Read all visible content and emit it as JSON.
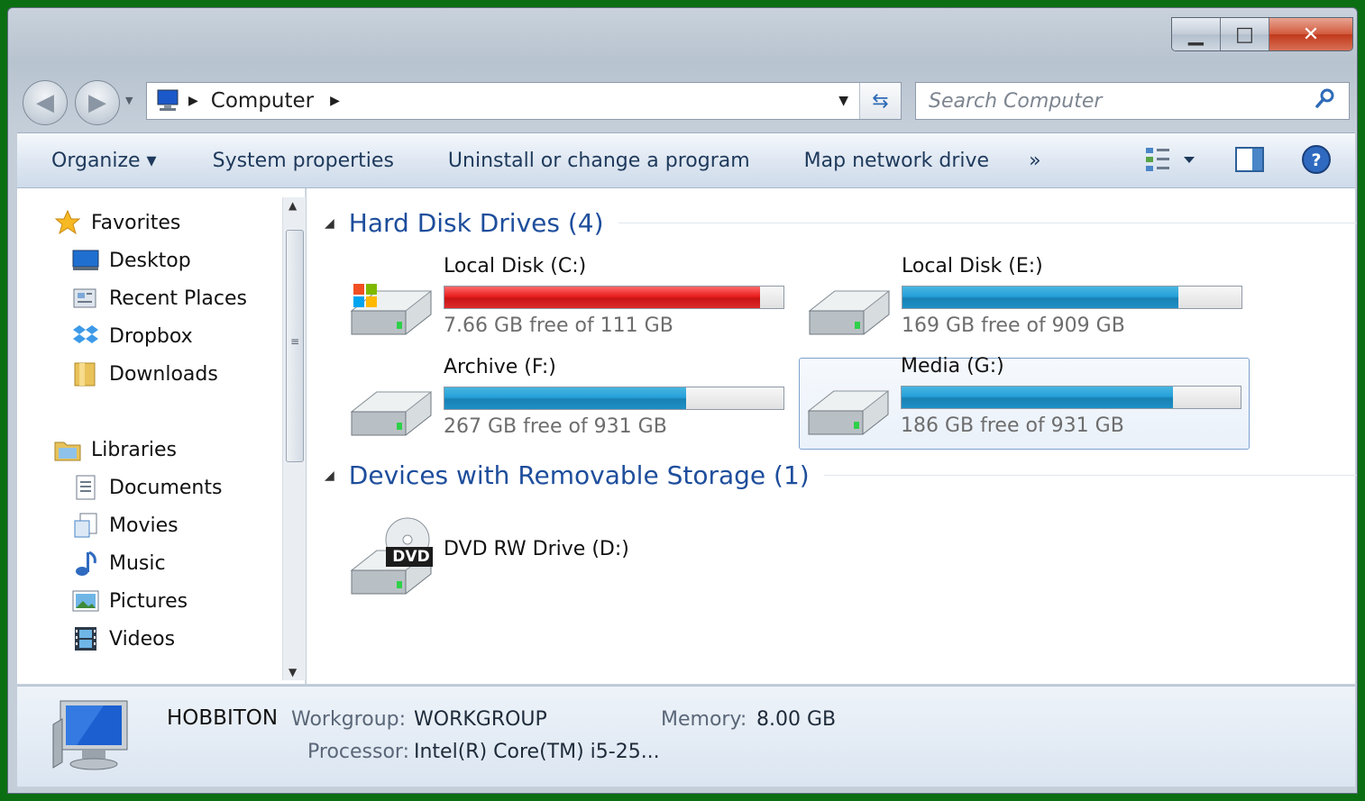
{
  "window": {
    "min_glyph": "▁",
    "max_glyph": "□",
    "close_glyph": "✕"
  },
  "nav": {
    "back_glyph": "◀",
    "forward_glyph": "▶",
    "breadcrumb": [
      "Computer"
    ],
    "search_placeholder": "Search Computer"
  },
  "toolbar": {
    "items": [
      "Organize ▾",
      "System properties",
      "Uninstall or change a program",
      "Map network drive",
      "»"
    ]
  },
  "sidebar": {
    "favorites_label": "Favorites",
    "favorites": [
      "Desktop",
      "Recent Places",
      "Dropbox",
      "Downloads"
    ],
    "libraries_label": "Libraries",
    "libraries": [
      "Documents",
      "Movies",
      "Music",
      "Pictures",
      "Videos"
    ]
  },
  "groups": {
    "hdd_label": "Hard Disk Drives (4)",
    "removable_label": "Devices with Removable Storage (1)"
  },
  "drives": [
    {
      "name": "Local Disk (C:)",
      "free_text": "7.66 GB free of 111 GB",
      "used_fraction": 0.931,
      "state": "low"
    },
    {
      "name": "Local Disk (E:)",
      "free_text": "169 GB free of 909 GB",
      "used_fraction": 0.814,
      "state": "normal"
    },
    {
      "name": "Archive (F:)",
      "free_text": "267 GB free of 931 GB",
      "used_fraction": 0.713,
      "state": "normal"
    },
    {
      "name": "Media (G:)",
      "free_text": "186 GB free of 931 GB",
      "used_fraction": 0.8,
      "state": "normal",
      "selected": true
    }
  ],
  "removable": [
    {
      "name": "DVD RW Drive (D:)",
      "badge": "DVD"
    }
  ],
  "details": {
    "computer_name": "HOBBITON",
    "workgroup_label": "Workgroup:",
    "workgroup": "WORKGROUP",
    "memory_label": "Memory:",
    "memory": "8.00 GB",
    "processor_label": "Processor:",
    "processor": "Intel(R) Core(TM) i5-25..."
  },
  "colors": {
    "bar_normal": "#26a0da",
    "bar_low": "#ea1f1f",
    "group_heading": "#1e4e9c",
    "toolbar_text": "#1e395b"
  }
}
